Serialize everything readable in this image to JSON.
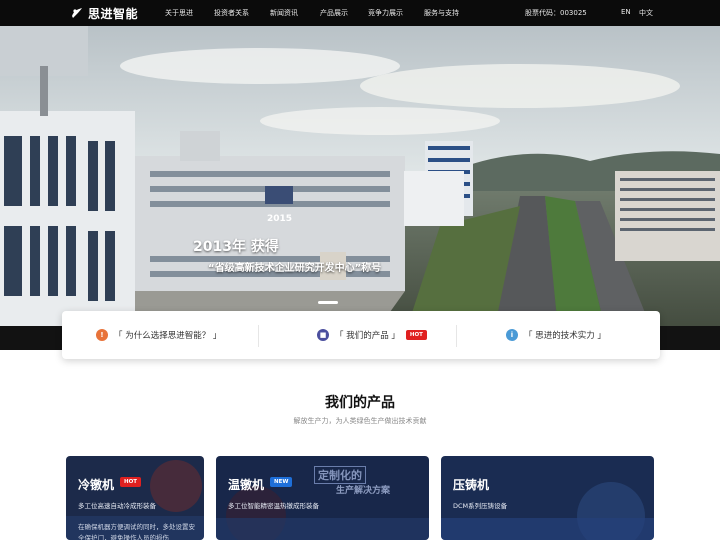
{
  "header": {
    "logo_text": "思进智能",
    "nav": [
      "关于思进",
      "投资者关系",
      "新闻资讯",
      "产品展示",
      "竞争力展示",
      "服务与支持"
    ],
    "stock_code": "股票代码：003025",
    "lang_en": "EN",
    "lang_cn": "中文"
  },
  "hero": {
    "sign_year": "2015",
    "caption_year": "2013年 获得",
    "caption_line": "“省级高新技术企业研究开发中心”称号"
  },
  "quick_links": [
    {
      "label": "「 为什么选择思进智能？ 」",
      "icon": "info-icon",
      "color": "#e8733a"
    },
    {
      "label": "「 我们的产品 」",
      "icon": "box-icon",
      "color": "#4b4f9e",
      "badge": "HOT"
    },
    {
      "label": "「 思进的技术实力 」",
      "icon": "tech-icon",
      "color": "#4a9ad6"
    }
  ],
  "products": {
    "title": "我们的产品",
    "subtitle": "解放生产力，为人类绿色生产做出技术贡献",
    "cards": [
      {
        "title": "冷镦机",
        "badge": "HOT",
        "badge_color": "#e02020",
        "desc": "多工位高速自动冷成形装备",
        "body": "在确保机器方便调试的同时，多处设置安全保护门，避免操作人员的损伤"
      },
      {
        "title": "温镦机",
        "badge": "NEW",
        "badge_color": "#1e6fd9",
        "desc": "多工位智能精密温热镦成形装备",
        "stamp_a": "定制化的",
        "stamp_b": "生产解决方案"
      },
      {
        "title": "压铸机",
        "desc": "DCM系列压铸设备"
      }
    ]
  }
}
